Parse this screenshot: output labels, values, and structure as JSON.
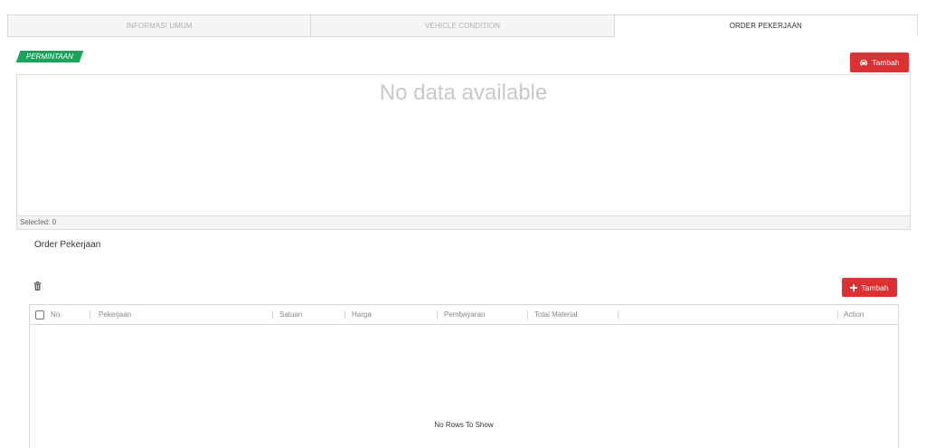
{
  "tabs": [
    {
      "label": "INFORMASI UMUM",
      "active": false
    },
    {
      "label": "VEHICLE CONDITION",
      "active": false
    },
    {
      "label": "ORDER PEKERJAAN",
      "active": true
    }
  ],
  "permintaan": {
    "badge_label": "PERMINTAAN",
    "add_button_label": "Tambah",
    "add_button_icon": "car-icon",
    "empty_text": "No data available",
    "selected_text": "Selected: 0"
  },
  "order": {
    "section_title": "Order Pekerjaan",
    "delete_icon": "trash-icon",
    "add_button_label": "Tambah",
    "add_button_icon": "plus-icon",
    "columns": [
      "No.",
      "Pekerjaan",
      "Satuan",
      "Harga",
      "Pembayaran",
      "Total Material",
      "",
      "Action"
    ],
    "no_rows_text": "No Rows To Show"
  },
  "colors": {
    "accent_red": "#dc3033",
    "badge_green": "#1aa35a"
  }
}
